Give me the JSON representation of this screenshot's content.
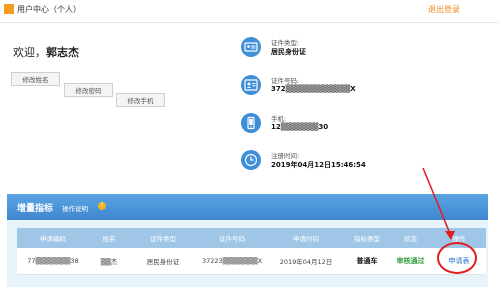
{
  "header": {
    "title": "用户中心（个人）",
    "logout": "退出登录",
    "icon": "user-center-icon"
  },
  "profile": {
    "welcome_prefix": "欢迎，",
    "name": "郭志杰",
    "buttons": {
      "edit_name": "修改姓名",
      "edit_password": "修改密码",
      "edit_phone": "修改手机"
    }
  },
  "info": {
    "cert_type_label": "证件类型:",
    "cert_type_value": "居民身份证",
    "cert_no_label": "证件号码:",
    "cert_no_value": "372▒▒▒▒▒▒▒▒▒▒▒▒X",
    "phone_label": "手机:",
    "phone_value": "12▒▒▒▒▒▒▒30",
    "reg_label": "注册时间:",
    "reg_value": "2019年04月12日15:46:54"
  },
  "panel": {
    "title": "增量指标",
    "help": "操作说明",
    "help_icon": "?"
  },
  "table": {
    "headers": [
      "申请编码",
      "姓名",
      "证件类型",
      "证件号码",
      "申请时间",
      "指标类型",
      "状态",
      "操作"
    ],
    "rows": [
      [
        "77▒▒▒▒▒▒▒38",
        "▒▒杰",
        "居民身份证",
        "37223▒▒▒▒▒▒▒X",
        "2019年04月12日",
        "普通车",
        "审核通过",
        "申请表"
      ]
    ]
  },
  "colors": {
    "accent": "#3f8fd8",
    "logout": "#f08a1c",
    "status_ok": "#2e9e3c",
    "annotation": "#e02020"
  }
}
